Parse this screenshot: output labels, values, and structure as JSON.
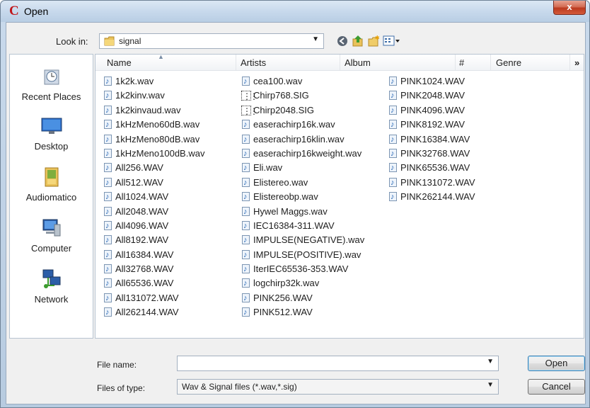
{
  "window": {
    "title": "Open",
    "close_glyph": "x"
  },
  "look_in": {
    "label": "Look in:",
    "value": "signal"
  },
  "places": [
    {
      "label": "Recent Places",
      "icon": "recent-places-icon"
    },
    {
      "label": "Desktop",
      "icon": "desktop-icon"
    },
    {
      "label": "Audiomatico",
      "icon": "user-folder-icon"
    },
    {
      "label": "Computer",
      "icon": "computer-icon"
    },
    {
      "label": "Network",
      "icon": "network-icon"
    }
  ],
  "columns": [
    "Name",
    "Artists",
    "Album",
    "#",
    "Genre",
    "»"
  ],
  "files": {
    "col1": [
      "1k2k.wav",
      "1k2kinv.wav",
      "1k2kinvaud.wav",
      "1kHzMeno60dB.wav",
      "1kHzMeno80dB.wav",
      "1kHzMeno100dB.wav",
      "All256.WAV",
      "All512.WAV",
      "All1024.WAV",
      "All2048.WAV",
      "All4096.WAV",
      "All8192.WAV",
      "All16384.WAV",
      "All32768.WAV",
      "All65536.WAV",
      "All131072.WAV",
      "All262144.WAV"
    ],
    "col2": [
      "cea100.wav",
      "Chirp768.SIG",
      "Chirp2048.SIG",
      "easerachirp16k.wav",
      "easerachirp16klin.wav",
      "easerachirp16kweight.wav",
      "Eli.wav",
      "Elistereo.wav",
      "Elistereobp.wav",
      "Hywel Maggs.wav",
      "IEC16384-311.WAV",
      "IMPULSE(NEGATIVE).wav",
      "IMPULSE(POSITIVE).wav",
      "IterIEC65536-353.WAV",
      "logchirp32k.wav",
      "PINK256.WAV",
      "PINK512.WAV"
    ],
    "col3": [
      "PINK1024.WAV",
      "PINK2048.WAV",
      "PINK4096.WAV",
      "PINK8192.WAV",
      "PINK16384.WAV",
      "PINK32768.WAV",
      "PINK65536.WAV",
      "PINK131072.WAV",
      "PINK262144.WAV"
    ]
  },
  "file_name": {
    "label": "File name:",
    "value": ""
  },
  "file_type": {
    "label": "Files of type:",
    "value": "Wav & Signal files (*.wav,*.sig)"
  },
  "buttons": {
    "open": "Open",
    "cancel": "Cancel"
  },
  "colors": {
    "title_bar": "#c8d9ec",
    "close_button": "#c4452a",
    "app_icon": "#c0161a"
  }
}
